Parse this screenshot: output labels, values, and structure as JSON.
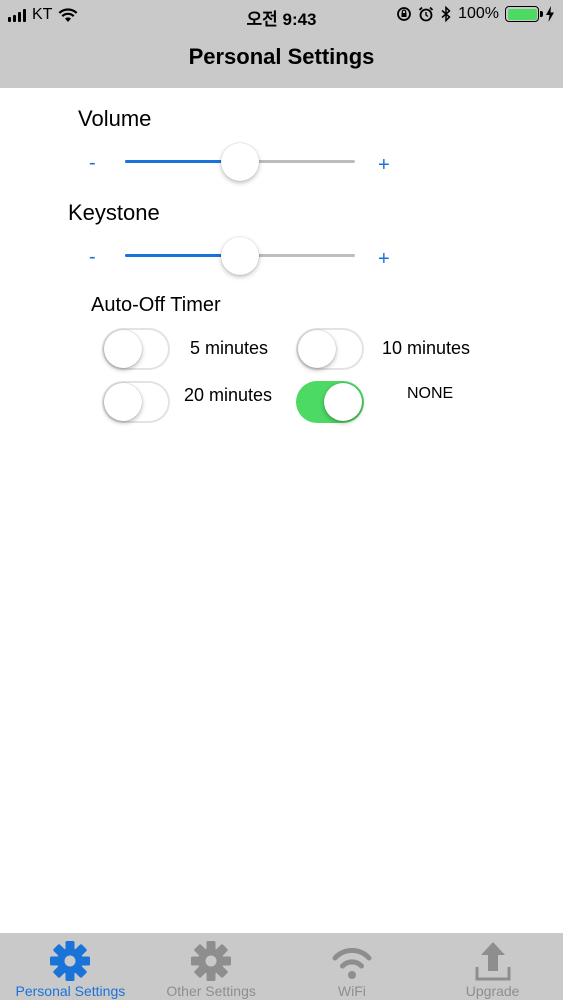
{
  "status_bar": {
    "carrier": "KT",
    "time": "오전 9:43",
    "battery_percent": "100%"
  },
  "header": {
    "title": "Personal Settings"
  },
  "volume": {
    "label": "Volume",
    "minus": "-",
    "plus": "+",
    "value_fraction": 0.5
  },
  "keystone": {
    "label": "Keystone",
    "minus": "-",
    "plus": "+",
    "value_fraction": 0.5
  },
  "auto_off": {
    "title": "Auto-Off Timer",
    "options": [
      {
        "label": "5 minutes",
        "on": false
      },
      {
        "label": "10 minutes",
        "on": false
      },
      {
        "label": "20 minutes",
        "on": false
      },
      {
        "label": "NONE",
        "on": true
      }
    ]
  },
  "tab_bar": {
    "tabs": [
      {
        "label": "Personal Settings",
        "icon": "gear-icon",
        "active": true
      },
      {
        "label": "Other Settings",
        "icon": "gear-icon",
        "active": false
      },
      {
        "label": "WiFi",
        "icon": "wifi-icon",
        "active": false
      },
      {
        "label": "Upgrade",
        "icon": "upload-icon",
        "active": false
      }
    ]
  },
  "colors": {
    "accent": "#1a73d9",
    "toggle_on": "#4cd964",
    "bar_gray": "#c9c9c9",
    "inactive_tab": "#8e8e8e"
  }
}
